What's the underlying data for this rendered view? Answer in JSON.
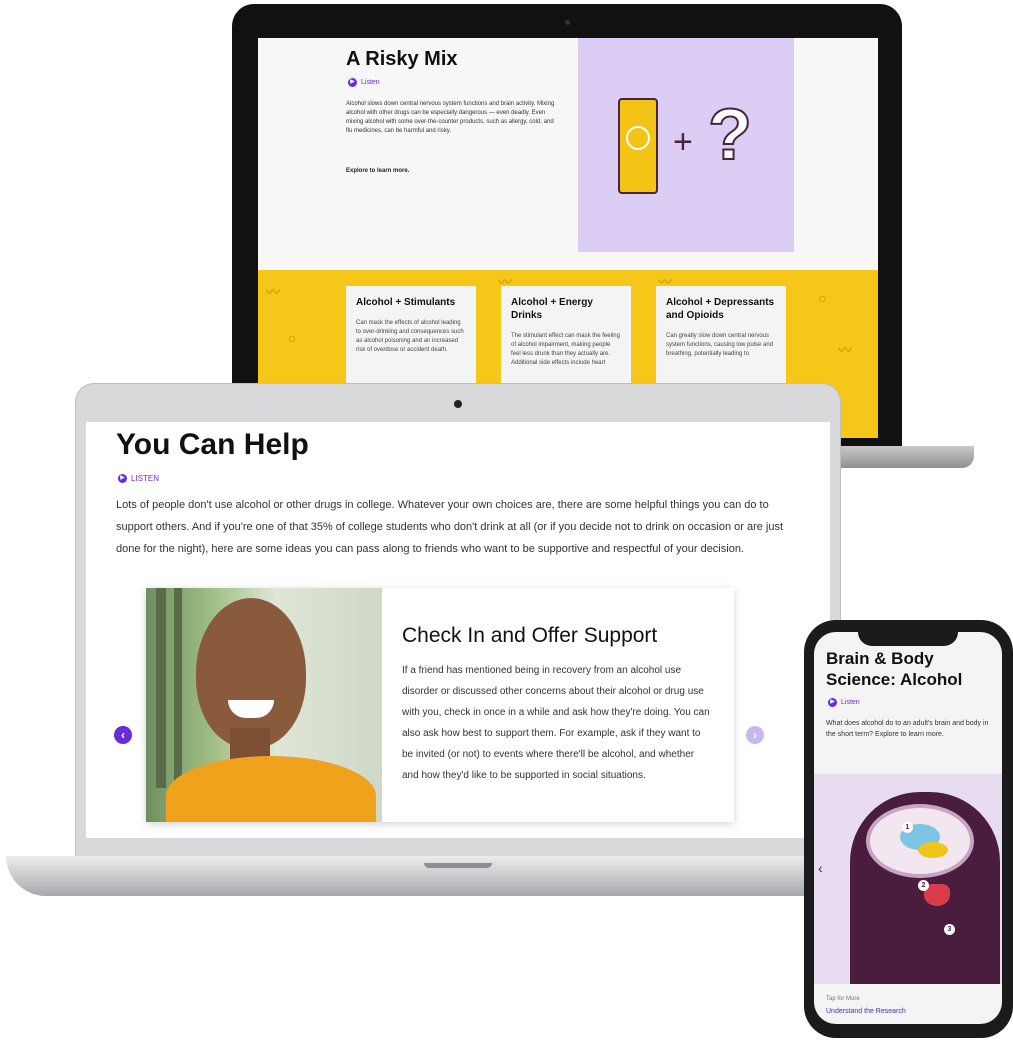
{
  "back_laptop": {
    "title": "A Risky Mix",
    "listen_label": "Listen",
    "body": "Alcohol slows down central nervous system functions and brain activity. Mixing alcohol with other drugs can be especially dangerous — even deadly. Even mixing alcohol with some over-the-counter products, such as allergy, cold, and flu medicines, can be harmful and risky.",
    "explore_label": "Explore to learn more.",
    "cards": [
      {
        "title": "Alcohol + Stimulants",
        "body": "Can mask the effects of alcohol leading to over-drinking and consequences such as alcohol poisoning and an increased risk of overdose or accident death."
      },
      {
        "title": "Alcohol + Energy Drinks",
        "body": "The stimulant effect can mask the feeling of alcohol impairment, making people feel less drunk than they actually are. Additional side effects include heart"
      },
      {
        "title": "Alcohol + Depressants and Opioids",
        "body": "Can greatly slow down central nervous system functions, causing low pulse and breathing, potentially leading to"
      }
    ],
    "colors": {
      "art_bg": "#dccdf4",
      "band": "#f6c718",
      "accent": "#6a2bd9"
    }
  },
  "front_laptop": {
    "title": "You Can Help",
    "listen_label": "LISTEN",
    "body": "Lots of people don't use alcohol or other drugs in college. Whatever your own choices are, there are some helpful things you can do to support others. And if you're one of that 35% of college students who don't drink at all (or if you decide not to drink on occasion or are just done for the night), here are some ideas you can pass along to friends who want to be supportive and respectful of your decision.",
    "card": {
      "title": "Check In and Offer Support",
      "body": "If a friend has mentioned being in recovery from an alcohol use disorder or discussed other concerns about their alcohol or drug use with you, check in once in a while and ask how they're doing. You can also ask how best to support them. For example, ask if they want to be invited (or not) to events where there'll be alcohol, and whether and how they'd like to be supported in social situations."
    },
    "prev_icon": "chevron-left-icon",
    "next_icon": "chevron-right-icon",
    "colors": {
      "accent": "#6a2bd9",
      "next_arrow": "#c9b7f0"
    }
  },
  "phone": {
    "title": "Brain & Body Science: Alcohol",
    "listen_label": "Listen",
    "body": "What does alcohol do to an adult's brain and body in the short term? Explore to learn more.",
    "markers": [
      "1",
      "2",
      "3"
    ],
    "footer_label": "Tap for More",
    "footer_link": "Understand the Research",
    "colors": {
      "art_bg": "#e7dcf0",
      "head": "#4a1d3f"
    }
  }
}
